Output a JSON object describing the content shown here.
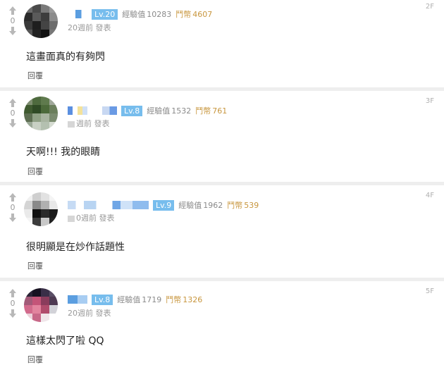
{
  "comments": [
    {
      "floor": "2F",
      "votes": "0",
      "level": "Lv.20",
      "exp_label": "經驗值",
      "exp": "10283",
      "coin_label": "鬥幣",
      "coins": "4607",
      "time": "20週前",
      "post_label": "發表",
      "text": "這畫面真的有夠閃",
      "reply": "回覆",
      "accent": "#4aa8e8"
    },
    {
      "floor": "3F",
      "votes": "0",
      "level": "Lv.8",
      "exp_label": "經驗值",
      "exp": "1532",
      "coin_label": "鬥幣",
      "coins": "761",
      "time": "週前",
      "post_label": "發表",
      "text": "天啊!!! 我的眼睛",
      "reply": "回覆",
      "accent": "#4aa8e8"
    },
    {
      "floor": "4F",
      "votes": "0",
      "level": "Lv.9",
      "exp_label": "經驗值",
      "exp": "1962",
      "coin_label": "鬥幣",
      "coins": "539",
      "time": "0週前",
      "post_label": "發表",
      "text": "很明顯是在炒作話題性",
      "reply": "回覆",
      "accent": "#4aa8e8"
    },
    {
      "floor": "5F",
      "votes": "0",
      "level": "Lv.8",
      "exp_label": "經驗值",
      "exp": "1719",
      "coin_label": "鬥幣",
      "coins": "1326",
      "time": "20週前",
      "post_label": "發表",
      "text": "這樣太閃了啦 QQ",
      "reply": "回覆",
      "accent": "#4aa8e8"
    }
  ]
}
